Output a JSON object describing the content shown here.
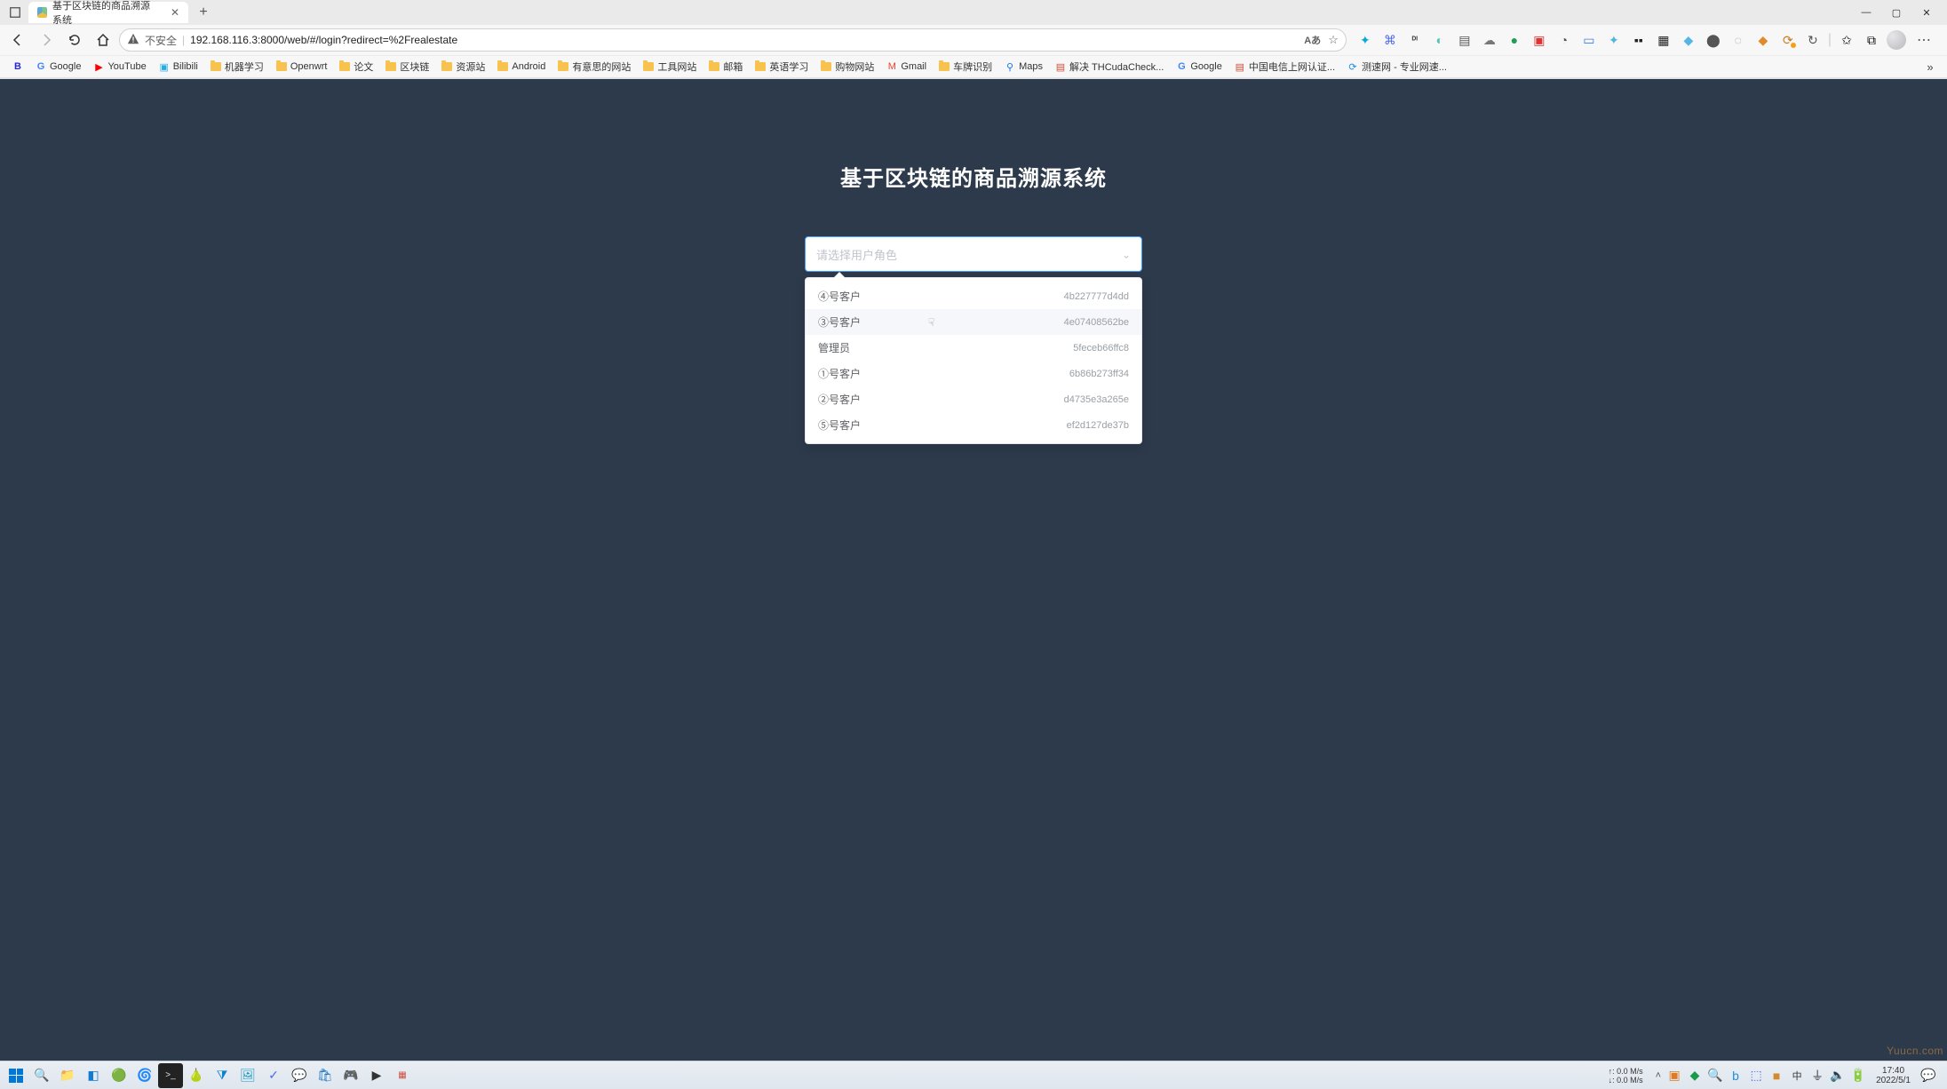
{
  "browser": {
    "tab_title": "基于区块链的商品溯源系统",
    "insecure_label": "不安全",
    "url": "192.168.116.3:8000/web/#/login?redirect=%2Frealestate",
    "reader_badge": "A",
    "more_label": "⋯"
  },
  "bookmarks": [
    {
      "icon": "baidu",
      "label": ""
    },
    {
      "icon": "google",
      "label": "Google"
    },
    {
      "icon": "youtube",
      "label": "YouTube"
    },
    {
      "icon": "bilibili",
      "label": "Bilibili"
    },
    {
      "icon": "folder",
      "label": "机器学习"
    },
    {
      "icon": "folder",
      "label": "Openwrt"
    },
    {
      "icon": "folder",
      "label": "论文"
    },
    {
      "icon": "folder",
      "label": "区块链"
    },
    {
      "icon": "folder",
      "label": "资源站"
    },
    {
      "icon": "folder",
      "label": "Android"
    },
    {
      "icon": "folder",
      "label": "有意思的网站"
    },
    {
      "icon": "folder",
      "label": "工具网站"
    },
    {
      "icon": "folder",
      "label": "邮箱"
    },
    {
      "icon": "folder",
      "label": "英语学习"
    },
    {
      "icon": "folder",
      "label": "购物网站"
    },
    {
      "icon": "gmail",
      "label": "Gmail"
    },
    {
      "icon": "folder",
      "label": "车牌识别"
    },
    {
      "icon": "maps",
      "label": "Maps"
    },
    {
      "icon": "page",
      "label": "解决 THCudaCheck..."
    },
    {
      "icon": "google",
      "label": "Google"
    },
    {
      "icon": "page",
      "label": "中国电信上网认证..."
    },
    {
      "icon": "speed",
      "label": "测速网 - 专业网速..."
    }
  ],
  "app": {
    "title": "基于区块链的商品溯源系统",
    "select_placeholder": "请选择用户角色",
    "dropdown": [
      {
        "label": "④号客户",
        "hash": "4b227777d4dd"
      },
      {
        "label": "③号客户",
        "hash": "4e07408562be",
        "hover": true,
        "cursor": true
      },
      {
        "label": "管理员",
        "hash": "5feceb66ffc8"
      },
      {
        "label": "①号客户",
        "hash": "6b86b273ff34"
      },
      {
        "label": "②号客户",
        "hash": "d4735e3a265e"
      },
      {
        "label": "⑤号客户",
        "hash": "ef2d127de37b"
      }
    ]
  },
  "watermark_br": "Yuucn.com",
  "taskbar": {
    "netspeed_up": "↑: 0.0 M/s",
    "netspeed_down": "↓: 0.0 M/s",
    "ime": "中",
    "time": "17:40",
    "date": "2022/5/1"
  }
}
